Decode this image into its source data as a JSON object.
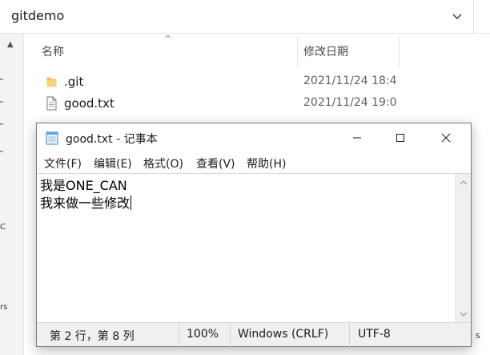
{
  "explorer": {
    "folder_title": "gitdemo",
    "columns": {
      "name": "名称",
      "date": "修改日期"
    },
    "files": [
      {
        "name": ".git",
        "date": "2021/11/24 18:4",
        "icon": "folder-icon"
      },
      {
        "name": "good.txt",
        "date": "2021/11/24 19:0",
        "icon": "text-file-icon"
      }
    ],
    "left_edge_text": [
      "C",
      "rs"
    ],
    "right_edge_text": "s"
  },
  "notepad": {
    "title": "good.txt - 记事本",
    "menu": [
      "文件(F)",
      "编辑(E)",
      "格式(O)",
      "查看(V)",
      "帮助(H)"
    ],
    "lines": [
      "我是ONE_CAN",
      "我来做一些修改"
    ],
    "status": {
      "position": "第 2 行，第 8 列",
      "zoom": "100%",
      "line_ending": "Windows (CRLF)",
      "encoding": "UTF-8"
    }
  },
  "colors": {
    "folder": "#f2c45a",
    "accent": "#0063b1"
  }
}
